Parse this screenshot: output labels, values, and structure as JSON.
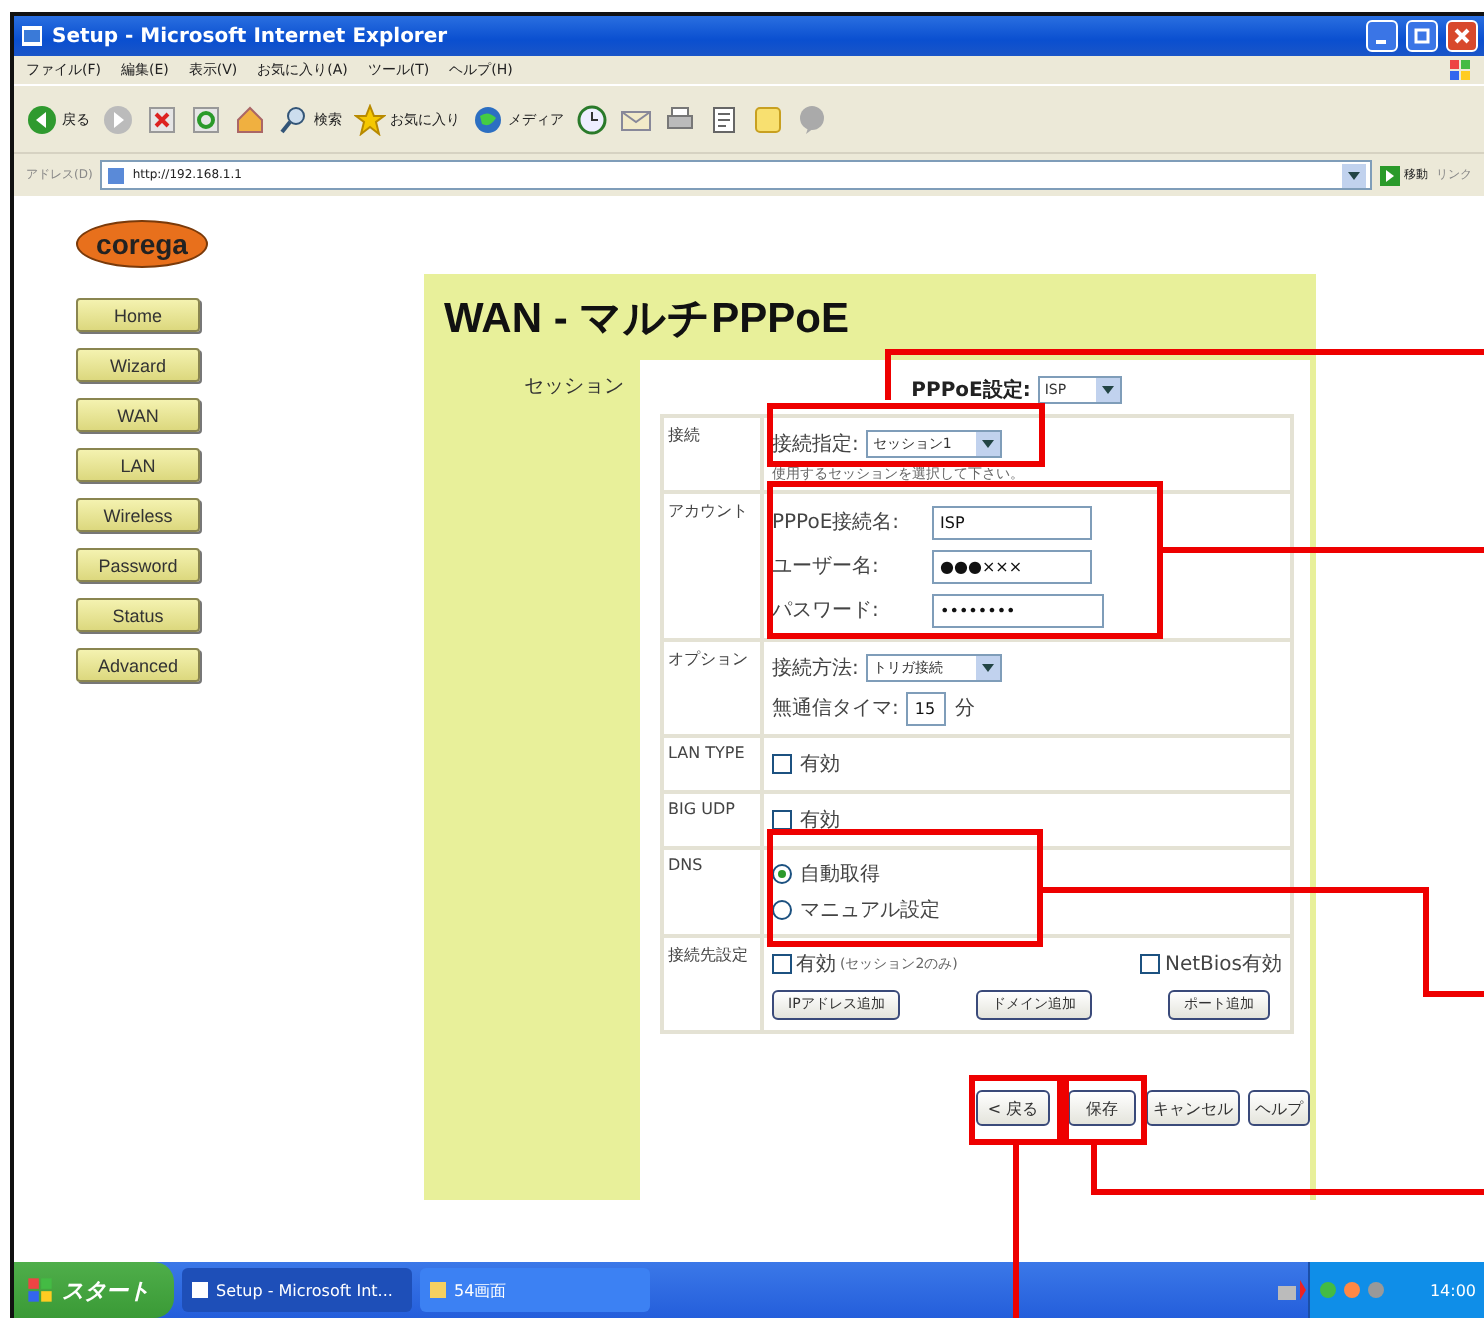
{
  "window": {
    "title": "Setup - Microsoft Internet Explorer"
  },
  "menu_bar": [
    "ファイル(F)",
    "編集(E)",
    "表示(V)",
    "お気に入り(A)",
    "ツール(T)",
    "ヘルプ(H)"
  ],
  "toolbar": [
    {
      "kind": "back",
      "label": "戻る"
    },
    {
      "kind": "forward"
    },
    {
      "kind": "stop"
    },
    {
      "kind": "refresh"
    },
    {
      "kind": "home"
    },
    {
      "kind": "search",
      "label": "検索"
    },
    {
      "kind": "favorites",
      "label": "お気に入り"
    },
    {
      "kind": "media",
      "label": "メディア"
    },
    {
      "kind": "history"
    },
    {
      "kind": "mail"
    },
    {
      "kind": "print"
    },
    {
      "kind": "edit"
    },
    {
      "kind": "note"
    },
    {
      "kind": "chat"
    }
  ],
  "address_bar": {
    "label": "アドレス(D)",
    "value": "http://192.168.1.1",
    "go": "移動",
    "links": "リンク"
  },
  "logo": "corega",
  "nav": [
    "Home",
    "Wizard",
    "WAN",
    "LAN",
    "Wireless",
    "Password",
    "Status",
    "Advanced"
  ],
  "page": {
    "title": "WAN - マルチPPPoE",
    "session_label": "セッション",
    "pppoe": {
      "label": "PPPoE設定:",
      "value": "ISP"
    },
    "rows": [
      {
        "label": "接続",
        "items": [
          {
            "kind": "select",
            "label": "接続指定:",
            "value": "セッション1"
          },
          {
            "kind": "note",
            "text": "使用するセッションを選択して下さい。"
          }
        ]
      },
      {
        "label": "アカウント",
        "items": [
          {
            "kind": "text",
            "label": "PPPoE接続名:",
            "value": "ISP"
          },
          {
            "kind": "text",
            "label": "ユーザー名:",
            "value": "●●●×××"
          },
          {
            "kind": "text",
            "label": "パスワード:",
            "value": "••••••••"
          }
        ]
      },
      {
        "label": "オプション",
        "items": [
          {
            "kind": "select",
            "label": "接続方法:",
            "value": "トリガ接続"
          },
          {
            "kind": "number",
            "label": "無通信タイマ:",
            "value": "15",
            "unit": "分"
          }
        ]
      },
      {
        "label": "LAN TYPE",
        "items": [
          {
            "kind": "checkbox",
            "label": "有効",
            "checked": false
          }
        ]
      },
      {
        "label": "BIG UDP",
        "items": [
          {
            "kind": "checkbox",
            "label": "有効",
            "checked": false
          }
        ]
      },
      {
        "label": "DNS",
        "items": [
          {
            "kind": "radio",
            "label": "自動取得",
            "selected": true
          },
          {
            "kind": "radio",
            "label": "マニュアル設定",
            "selected": false
          }
        ]
      },
      {
        "label": "接続先設定",
        "items": [
          {
            "kind": "checkboxes",
            "boxes": [
              {
                "label": "有効",
                "note": "(セッション2のみ)",
                "checked": false
              },
              {
                "label": "NetBios有効",
                "checked": false
              }
            ]
          },
          {
            "kind": "buttons",
            "buttons": [
              "IPアドレス追加",
              "ドメイン追加",
              "ポート追加"
            ]
          }
        ]
      }
    ],
    "buttons": [
      "< 戻る",
      "保存",
      "キャンセル",
      "ヘルプ"
    ]
  },
  "taskbar": {
    "start": "スタート",
    "tasks": [
      {
        "label": "Setup - Microsoft Int...",
        "selected": true
      },
      {
        "label": "54画面",
        "selected": false
      }
    ],
    "clock": "14:00"
  }
}
